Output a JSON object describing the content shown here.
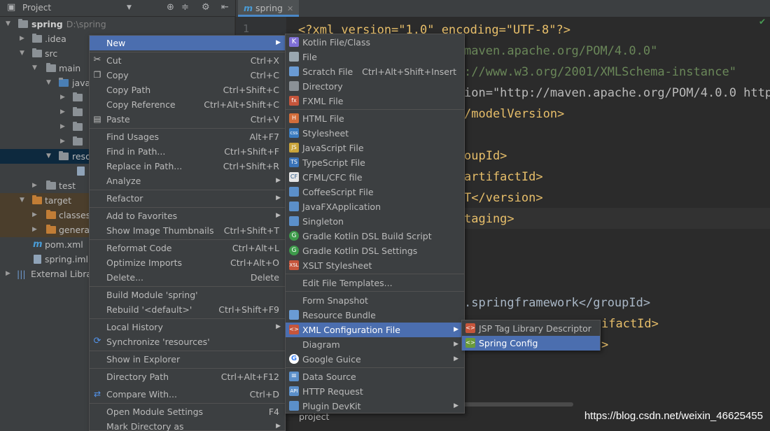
{
  "project_panel": {
    "title": "Project",
    "tree": [
      {
        "label": "spring",
        "path": "D:\\spring"
      },
      {
        "label": ".idea"
      },
      {
        "label": "src"
      },
      {
        "label": "main"
      },
      {
        "label": "java"
      },
      {
        "label": "resources"
      },
      {
        "label": "test"
      },
      {
        "label": "target"
      },
      {
        "label": "classes"
      },
      {
        "label": "generated"
      },
      {
        "label": "pom.xml"
      },
      {
        "label": "spring.iml"
      },
      {
        "label": "External Libraries"
      }
    ]
  },
  "editor": {
    "tab_label": "spring",
    "tab_icon": "m",
    "line_numbers": [
      "1"
    ],
    "lines": [
      "<?xml version=\"1.0\" encoding=\"UTF-8\"?>",
      "maven.apache.org/POM/4.0.0\"",
      "://www.w3.org/2001/XMLSchema-instance\"",
      "ion=\"http://maven.apache.org/POM/4.0.0 http",
      "/modelVersion>",
      "",
      "oupId>",
      "artifactId>",
      "T</version>",
      "taging>",
      "",
      "",
      ".springframework</groupId>",
      "ifactId>",
      ">"
    ],
    "breadcrumb": "project"
  },
  "watermark": "https://blog.csdn.net/weixin_46625455",
  "context_menu": {
    "items": [
      {
        "label": "New",
        "shortcut": "",
        "submenu": true
      },
      {
        "label": "Cut",
        "shortcut": "Ctrl+X"
      },
      {
        "label": "Copy",
        "shortcut": "Ctrl+C"
      },
      {
        "label": "Copy Path",
        "shortcut": "Ctrl+Shift+C"
      },
      {
        "label": "Copy Reference",
        "shortcut": "Ctrl+Alt+Shift+C"
      },
      {
        "label": "Paste",
        "shortcut": "Ctrl+V"
      },
      {
        "label": "Find Usages",
        "shortcut": "Alt+F7"
      },
      {
        "label": "Find in Path...",
        "shortcut": "Ctrl+Shift+F"
      },
      {
        "label": "Replace in Path...",
        "shortcut": "Ctrl+Shift+R"
      },
      {
        "label": "Analyze",
        "shortcut": "",
        "submenu": true
      },
      {
        "label": "Refactor",
        "shortcut": "",
        "submenu": true
      },
      {
        "label": "Add to Favorites",
        "shortcut": "",
        "submenu": true
      },
      {
        "label": "Show Image Thumbnails",
        "shortcut": "Ctrl+Shift+T"
      },
      {
        "label": "Reformat Code",
        "shortcut": "Ctrl+Alt+L"
      },
      {
        "label": "Optimize Imports",
        "shortcut": "Ctrl+Alt+O"
      },
      {
        "label": "Delete...",
        "shortcut": "Delete"
      },
      {
        "label": "Build Module 'spring'",
        "shortcut": ""
      },
      {
        "label": "Rebuild '<default>'",
        "shortcut": "Ctrl+Shift+F9"
      },
      {
        "label": "Local History",
        "shortcut": "",
        "submenu": true
      },
      {
        "label": "Synchronize 'resources'",
        "shortcut": ""
      },
      {
        "label": "Show in Explorer",
        "shortcut": ""
      },
      {
        "label": "Directory Path",
        "shortcut": "Ctrl+Alt+F12"
      },
      {
        "label": "Compare With...",
        "shortcut": "Ctrl+D"
      },
      {
        "label": "Open Module Settings",
        "shortcut": "F4"
      },
      {
        "label": "Mark Directory as",
        "shortcut": "",
        "submenu": true
      }
    ]
  },
  "new_submenu": {
    "items": [
      {
        "label": "Kotlin File/Class",
        "shortcut": ""
      },
      {
        "label": "File",
        "shortcut": ""
      },
      {
        "label": "Scratch File",
        "shortcut": "Ctrl+Alt+Shift+Insert"
      },
      {
        "label": "Directory",
        "shortcut": ""
      },
      {
        "label": "FXML File",
        "shortcut": ""
      },
      {
        "label": "HTML File",
        "shortcut": ""
      },
      {
        "label": "Stylesheet",
        "shortcut": ""
      },
      {
        "label": "JavaScript File",
        "shortcut": ""
      },
      {
        "label": "TypeScript File",
        "shortcut": ""
      },
      {
        "label": "CFML/CFC file",
        "shortcut": ""
      },
      {
        "label": "CoffeeScript File",
        "shortcut": ""
      },
      {
        "label": "JavaFXApplication",
        "shortcut": ""
      },
      {
        "label": "Singleton",
        "shortcut": ""
      },
      {
        "label": "Gradle Kotlin DSL Build Script",
        "shortcut": ""
      },
      {
        "label": "Gradle Kotlin DSL Settings",
        "shortcut": ""
      },
      {
        "label": "XSLT Stylesheet",
        "shortcut": ""
      },
      {
        "label": "Edit File Templates...",
        "shortcut": ""
      },
      {
        "label": "Form Snapshot",
        "shortcut": ""
      },
      {
        "label": "Resource Bundle",
        "shortcut": ""
      },
      {
        "label": "XML Configuration File",
        "shortcut": "",
        "submenu": true
      },
      {
        "label": "Diagram",
        "shortcut": "",
        "submenu": true
      },
      {
        "label": "Google Guice",
        "shortcut": "",
        "submenu": true
      },
      {
        "label": "Data Source",
        "shortcut": ""
      },
      {
        "label": "HTTP Request",
        "shortcut": ""
      },
      {
        "label": "Plugin DevKit",
        "shortcut": "",
        "submenu": true
      }
    ]
  },
  "xml_submenu": {
    "items": [
      {
        "label": "JSP Tag Library Descriptor"
      },
      {
        "label": "Spring Config"
      }
    ]
  },
  "colors": {
    "highlight": "#4b6eaf",
    "menu_bg": "#3c3f41",
    "editor_bg": "#2b2b2b",
    "xml_tag": "#e8bf6a",
    "xml_string": "#6a8759"
  }
}
